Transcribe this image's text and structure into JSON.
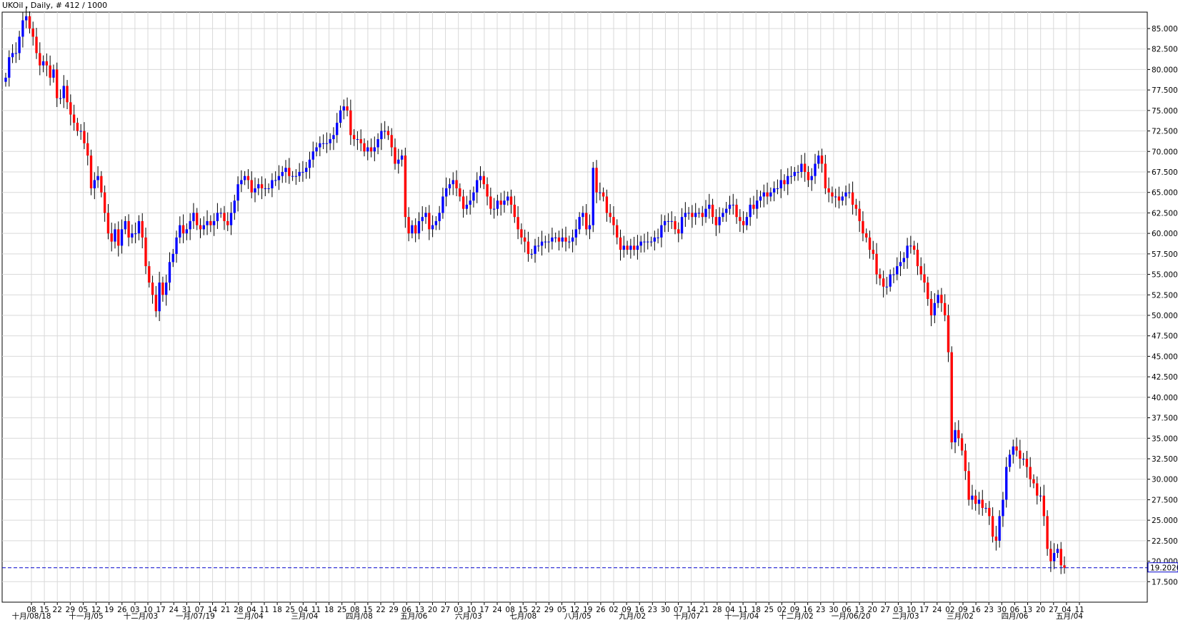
{
  "header": {
    "title": "UKOil , Daily, # 412 / 1000"
  },
  "colors": {
    "up": "#0000ff",
    "down": "#ff0000",
    "wick": "#000000",
    "grid": "#d9d9d9",
    "current_line": "#0000cc",
    "current_label_bg": "#0000cc"
  },
  "chart_data": {
    "type": "candlestick",
    "title": "UKOil , Daily, # 412 / 1000",
    "ylim": [
      15.0,
      87.0
    ],
    "y_ticks": [
      "85.0000",
      "82.5000",
      "80.0000",
      "77.5000",
      "75.0000",
      "72.5000",
      "70.0000",
      "67.5000",
      "65.0000",
      "62.5000",
      "60.0000",
      "57.5000",
      "55.0000",
      "52.5000",
      "50.0000",
      "47.5000",
      "45.0000",
      "42.5000",
      "40.0000",
      "37.5000",
      "35.0000",
      "32.5000",
      "30.0000",
      "27.5000",
      "25.0000",
      "22.5000",
      "20.0000",
      "17.5000"
    ],
    "y_tick_values": [
      85,
      82.5,
      80,
      77.5,
      75,
      72.5,
      70,
      67.5,
      65,
      62.5,
      60,
      57.5,
      55,
      52.5,
      50,
      47.5,
      45,
      42.5,
      40,
      37.5,
      35,
      32.5,
      30,
      27.5,
      25,
      22.5,
      20,
      17.5
    ],
    "x_day_labels": [
      "08",
      "15",
      "22",
      "29",
      "05",
      "12",
      "19",
      "26",
      "03",
      "10",
      "17",
      "24",
      "31",
      "07",
      "14",
      "21",
      "28",
      "04",
      "11",
      "18",
      "25",
      "04",
      "11",
      "18",
      "25",
      "08",
      "15",
      "22",
      "29",
      "06",
      "13",
      "20",
      "27",
      "03",
      "10",
      "17",
      "24",
      "08",
      "15",
      "22",
      "29",
      "05",
      "12",
      "19",
      "26",
      "02",
      "09",
      "16",
      "23",
      "30",
      "07",
      "14",
      "21",
      "28",
      "04",
      "11",
      "18",
      "25",
      "02",
      "09",
      "16",
      "23",
      "30",
      "06",
      "13",
      "20",
      "27",
      "03",
      "10",
      "17",
      "24",
      "02",
      "09",
      "16",
      "23",
      "30",
      "06",
      "13",
      "20",
      "27",
      "04",
      "11"
    ],
    "x_month_labels": [
      "十月/08/18",
      "十一月/05",
      "十二月/03",
      "一月/07/19",
      "二月/04",
      "三月/04",
      "四月/08",
      "五月/06",
      "六月/03",
      "七月/08",
      "八月/05",
      "九月/02",
      "十月/07",
      "十一月/04",
      "十二月/02",
      "一月/06/20",
      "二月/03",
      "三月/02",
      "四月/06",
      "五月/04"
    ],
    "current_price": "19.2020",
    "series": [
      {
        "values": [
          79.0,
          81.5,
          82.0,
          82.0,
          84.0,
          86.0,
          86.5,
          85.0,
          84.0,
          82.0,
          80.5,
          81.0,
          80.5,
          79.0,
          80.0,
          76.5,
          76.5,
          78.0,
          76.0,
          74.5,
          73.5,
          72.5,
          72.5,
          71.0,
          69.5,
          65.5,
          66.5,
          67.0,
          65.0,
          62.5,
          60.0,
          59.0,
          60.5,
          58.5,
          60.5,
          61.5,
          59.5,
          60.0,
          60.0,
          61.5,
          59.5,
          56.0,
          54.0,
          52.5,
          50.5,
          54.0,
          52.5,
          54.0,
          56.5,
          57.5,
          59.5,
          61.0,
          60.0,
          60.5,
          61.5,
          62.5,
          61.0,
          60.5,
          61.0,
          61.5,
          61.0,
          61.5,
          62.5,
          62.5,
          61.5,
          61.0,
          62.5,
          64.0,
          66.0,
          66.5,
          67.0,
          66.5,
          65.0,
          65.5,
          66.0,
          65.5,
          65.5,
          65.5,
          66.5,
          66.5,
          67.0,
          67.5,
          68.0,
          67.0,
          67.0,
          67.0,
          67.5,
          67.5,
          68.0,
          69.0,
          70.0,
          70.5,
          71.0,
          71.0,
          71.0,
          71.5,
          72.0,
          73.5,
          75.0,
          75.5,
          75.0,
          72.0,
          71.5,
          71.5,
          71.0,
          70.0,
          70.5,
          70.0,
          70.5,
          71.5,
          72.5,
          72.5,
          72.0,
          70.5,
          68.5,
          69.0,
          69.5,
          62.0,
          60.0,
          61.0,
          60.0,
          61.5,
          62.0,
          62.5,
          60.5,
          61.0,
          61.5,
          62.5,
          64.5,
          65.5,
          66.0,
          66.5,
          65.5,
          64.5,
          63.0,
          63.5,
          64.0,
          65.0,
          66.5,
          67.0,
          66.0,
          64.5,
          63.0,
          63.0,
          64.0,
          63.5,
          64.0,
          64.5,
          63.5,
          62.0,
          60.5,
          59.5,
          59.0,
          57.5,
          57.5,
          58.5,
          58.5,
          59.0,
          59.0,
          59.0,
          59.5,
          59.5,
          59.0,
          59.5,
          59.0,
          59.0,
          59.5,
          60.5,
          62.0,
          62.5,
          60.5,
          61.0,
          68.0,
          65.0,
          65.0,
          64.5,
          62.5,
          62.0,
          61.0,
          59.5,
          58.0,
          58.5,
          58.0,
          58.5,
          58.0,
          58.5,
          59.0,
          59.0,
          59.0,
          59.0,
          59.5,
          59.5,
          61.0,
          61.5,
          61.5,
          61.5,
          60.5,
          60.0,
          62.0,
          62.5,
          62.5,
          62.0,
          62.5,
          62.5,
          62.0,
          63.0,
          63.5,
          62.0,
          61.0,
          62.0,
          62.5,
          63.0,
          63.5,
          63.5,
          62.0,
          61.5,
          61.0,
          62.0,
          63.5,
          63.0,
          64.0,
          64.5,
          65.0,
          64.5,
          65.0,
          65.5,
          65.5,
          66.5,
          66.0,
          67.0,
          67.0,
          67.5,
          67.5,
          68.5,
          67.5,
          66.5,
          67.0,
          68.5,
          69.5,
          68.5,
          65.5,
          65.0,
          64.5,
          64.5,
          64.0,
          64.5,
          65.0,
          65.0,
          63.5,
          63.0,
          61.5,
          60.0,
          59.5,
          58.0,
          57.5,
          55.0,
          54.5,
          53.5,
          53.5,
          55.0,
          55.0,
          56.0,
          56.5,
          57.0,
          58.5,
          58.5,
          58.0,
          56.0,
          55.0,
          54.0,
          52.0,
          50.0,
          51.5,
          52.5,
          51.5,
          50.0,
          45.5,
          34.5,
          36.0,
          35.0,
          33.5,
          31.0,
          27.5,
          28.0,
          27.0,
          27.5,
          26.5,
          26.5,
          25.5,
          23.0,
          22.5,
          25.5,
          27.5,
          31.5,
          33.0,
          34.0,
          33.5,
          32.5,
          32.5,
          31.5,
          30.0,
          29.5,
          28.0,
          28.0,
          25.5,
          21.5,
          20.0,
          21.0,
          21.5,
          19.5,
          19.2
        ]
      },
      {
        "values": [
          78.5,
          79.0,
          81.5,
          82.0,
          82.0,
          84.0,
          86.0,
          86.5,
          85.0,
          84.0,
          82.0,
          80.5,
          81.0,
          80.5,
          79.0,
          80.0,
          76.5,
          76.5,
          78.0,
          76.0,
          74.5,
          73.5,
          72.5,
          72.5,
          71.0,
          69.5,
          65.5,
          66.5,
          67.0,
          65.0,
          62.5,
          60.0,
          59.0,
          60.5,
          58.5,
          60.5,
          61.5,
          59.5,
          60.0,
          60.0,
          61.5,
          59.5,
          56.0,
          54.0,
          52.5,
          50.5,
          54.0,
          52.5,
          54.0,
          56.5,
          57.5,
          59.5,
          61.0,
          60.0,
          60.5,
          61.5,
          62.5,
          61.0,
          60.5,
          61.0,
          61.5,
          61.0,
          61.5,
          62.5,
          62.5,
          61.5,
          61.0,
          62.5,
          64.0,
          66.0,
          66.5,
          67.0,
          66.5,
          65.0,
          65.5,
          66.0,
          65.5,
          65.5,
          65.5,
          66.5,
          66.5,
          67.0,
          67.5,
          68.0,
          67.0,
          67.0,
          67.0,
          67.5,
          67.5,
          68.0,
          69.0,
          70.0,
          70.5,
          71.0,
          71.0,
          71.0,
          71.5,
          72.0,
          73.5,
          75.0,
          75.5,
          75.0,
          72.0,
          71.5,
          71.5,
          71.0,
          70.0,
          70.5,
          70.0,
          70.5,
          71.5,
          72.5,
          72.5,
          72.0,
          70.5,
          68.5,
          69.0,
          69.5,
          62.0,
          60.0,
          61.0,
          60.0,
          61.5,
          62.0,
          62.5,
          60.5,
          61.0,
          61.5,
          62.5,
          64.5,
          65.5,
          66.0,
          66.5,
          65.5,
          64.5,
          63.0,
          63.5,
          64.0,
          65.0,
          66.5,
          67.0,
          66.0,
          64.5,
          63.0,
          63.0,
          64.0,
          63.5,
          64.0,
          64.5,
          63.5,
          62.0,
          60.5,
          59.5,
          59.0,
          57.5,
          57.5,
          58.5,
          58.5,
          59.0,
          59.0,
          59.0,
          59.5,
          59.5,
          59.0,
          59.5,
          59.0,
          59.0,
          59.5,
          60.5,
          62.0,
          62.5,
          60.5,
          61.0,
          68.0,
          65.0,
          65.0,
          64.5,
          62.5,
          62.0,
          61.0,
          59.5,
          58.0,
          58.5,
          58.0,
          58.5,
          58.0,
          58.5,
          59.0,
          59.0,
          59.0,
          59.0,
          59.5,
          59.5,
          61.0,
          61.5,
          61.5,
          61.5,
          60.5,
          60.0,
          62.0,
          62.5,
          62.5,
          62.0,
          62.5,
          62.5,
          62.0,
          63.0,
          63.5,
          62.0,
          61.0,
          62.0,
          62.5,
          63.0,
          63.5,
          63.5,
          62.0,
          61.5,
          61.0,
          62.0,
          63.5,
          63.0,
          64.0,
          64.5,
          65.0,
          64.5,
          65.0,
          65.5,
          65.5,
          66.5,
          66.0,
          67.0,
          67.0,
          67.5,
          67.5,
          68.5,
          67.5,
          66.5,
          67.0,
          68.5,
          69.5,
          68.5,
          65.5,
          65.0,
          64.5,
          64.5,
          64.0,
          64.5,
          65.0,
          65.0,
          63.5,
          63.0,
          61.5,
          60.0,
          59.5,
          58.0,
          57.5,
          55.0,
          54.5,
          53.5,
          53.5,
          55.0,
          55.0,
          56.0,
          56.5,
          57.0,
          58.5,
          58.5,
          58.0,
          56.0,
          55.0,
          54.0,
          52.0,
          50.0,
          51.5,
          52.5,
          51.5,
          50.0,
          45.5,
          34.5,
          36.0,
          35.0,
          33.5,
          31.0,
          27.5,
          28.0,
          27.0,
          27.5,
          26.5,
          26.5,
          25.5,
          23.0,
          22.5,
          25.5,
          27.5,
          31.5,
          33.0,
          34.0,
          33.5,
          32.5,
          32.5,
          31.5,
          30.0,
          29.5,
          28.0,
          28.0,
          25.5,
          21.5,
          20.0,
          21.0,
          21.5,
          19.5
        ]
      }
    ]
  }
}
